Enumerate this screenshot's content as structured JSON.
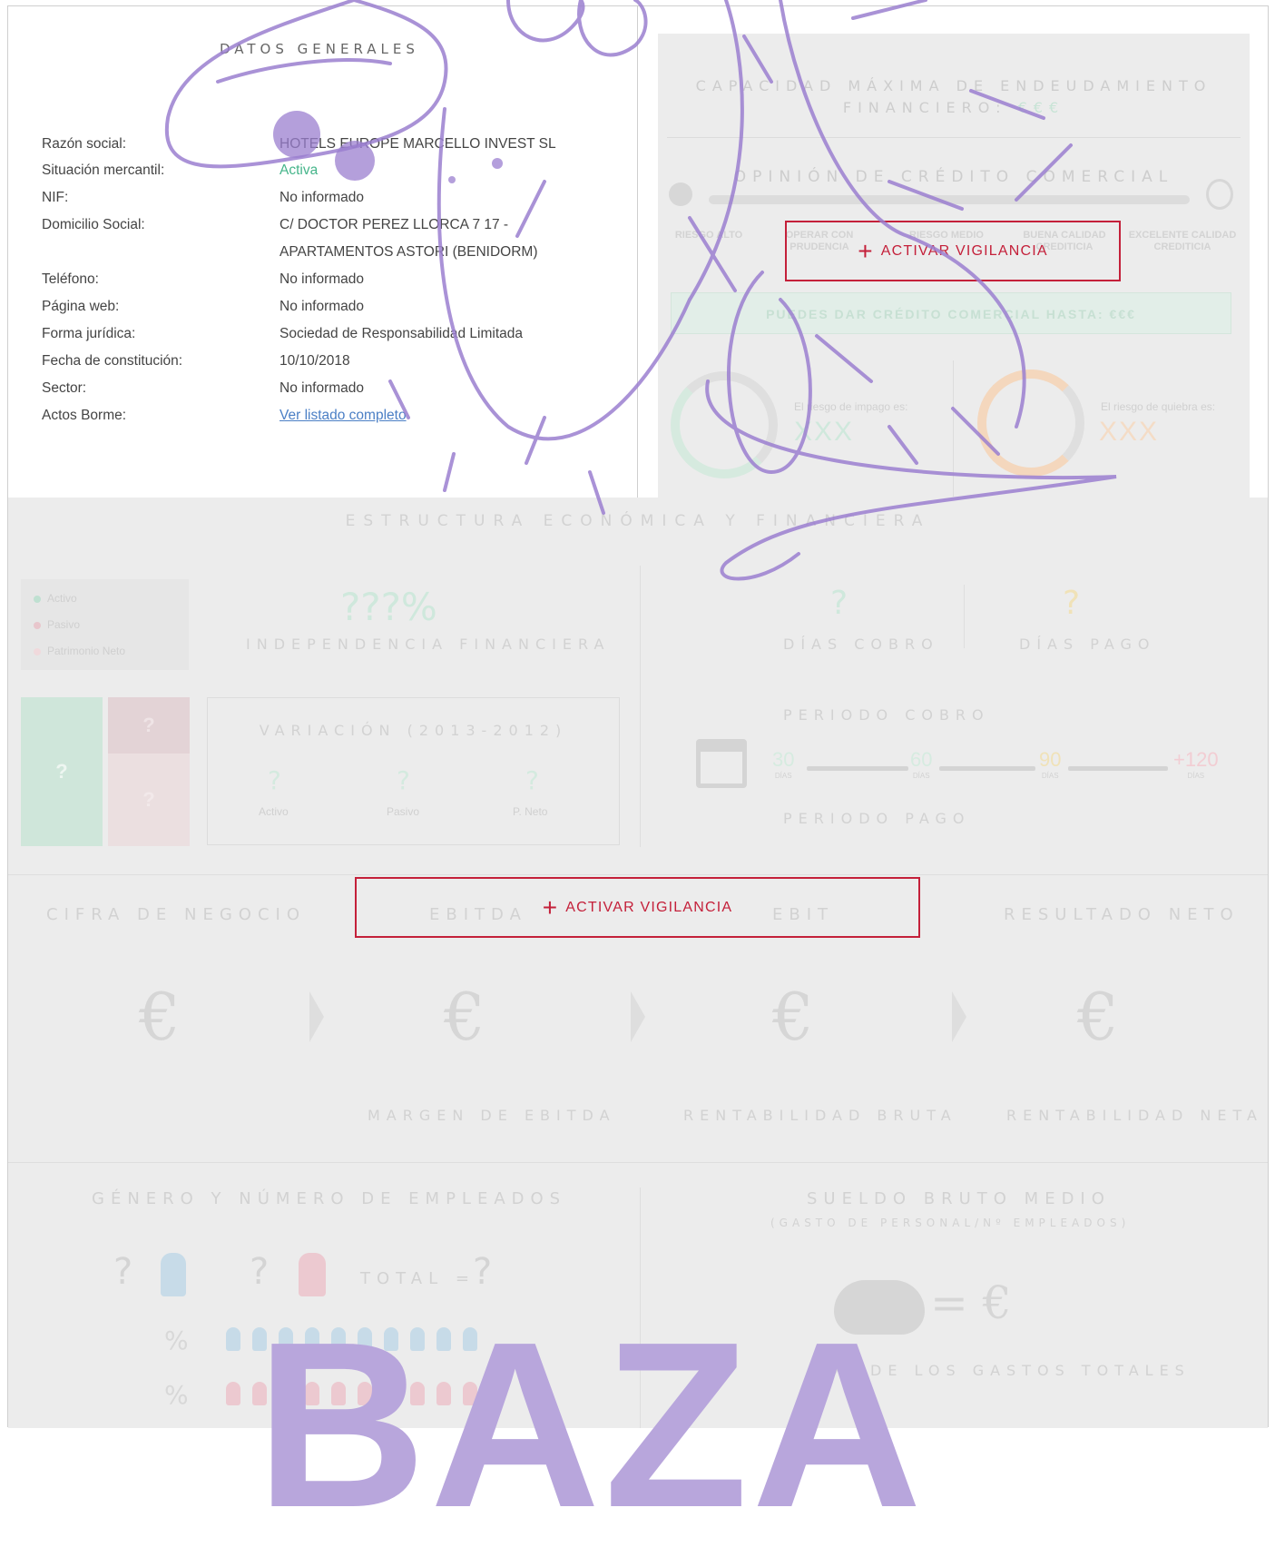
{
  "general": {
    "title": "DATOS GENERALES",
    "fields": [
      {
        "label": "Razón social:",
        "value": "HOTELS EUROPE MARCELLO INVEST SL"
      },
      {
        "label": "Situación mercantil:",
        "value": "Activa"
      },
      {
        "label": "NIF:",
        "value": "No informado"
      },
      {
        "label": "Domicilio Social:",
        "value": "C/ DOCTOR PEREZ LLORCA 7 17 - APARTAMENTOS ASTORI (BENIDORM)"
      },
      {
        "label": "Teléfono:",
        "value": "No informado"
      },
      {
        "label": "Página web:",
        "value": "No informado"
      },
      {
        "label": "Forma jurídica:",
        "value": "Sociedad de Responsabilidad Limitada"
      },
      {
        "label": "Fecha de constitución:",
        "value": "10/10/2018"
      },
      {
        "label": "Sector:",
        "value": "No informado"
      },
      {
        "label": "Actos Borme:",
        "value": "Ver listado completo"
      }
    ]
  },
  "credit": {
    "capacity_title": "CAPACIDAD MÁXIMA DE ENDEUDAMIENTO FINANCIERO:",
    "capacity_value": "€€€",
    "opinion_title": "OPINIÓN DE CRÉDITO COMERCIAL",
    "risk_labels": [
      "RIESGO ALTO",
      "OPERAR CON PRUDENCIA",
      "RIESGO MEDIO",
      "BUENA CALIDAD CREDITICIA",
      "EXCELENTE CALIDAD CREDITICIA"
    ],
    "credit_limit": "PUEDES DAR CRÉDITO COMERCIAL HASTA: €€€",
    "impago_label": "El riesgo de impago es:",
    "impago_value": "XXX",
    "quiebra_label": "El riesgo de quiebra es:",
    "quiebra_value": "XXX",
    "activate_label": "ACTIVAR VIGILANCIA"
  },
  "structure": {
    "title": "ESTRUCTURA ECONÓMICA Y FINANCIERA",
    "legend": [
      "Activo",
      "Pasivo",
      "Patrimonio Neto"
    ],
    "independence_value": "???%",
    "independence_label": "INDEPENDENCIA FINANCIERA",
    "bar_q": "?",
    "variation_title": "VARIACIÓN (2013-2012)",
    "variation_items": [
      {
        "q": "?",
        "label": "Activo"
      },
      {
        "q": "?",
        "label": "Pasivo"
      },
      {
        "q": "?",
        "label": "P. Neto"
      }
    ],
    "dias_cobro_q": "?",
    "dias_cobro_label": "DÍAS COBRO",
    "dias_pago_q": "?",
    "dias_pago_label": "DÍAS PAGO",
    "periodo_cobro": "PERIODO COBRO",
    "periodo_pago": "PERIODO PAGO",
    "ticks": [
      "30",
      "60",
      "90",
      "+120"
    ],
    "tick_unit": "DÍAS"
  },
  "results": {
    "headers": [
      "CIFRA DE NEGOCIO",
      "EBITDA",
      "EBIT",
      "RESULTADO NETO"
    ],
    "euro": "€",
    "footers": [
      "MARGEN DE EBITDA",
      "RENTABILIDAD BRUTA",
      "RENTABILIDAD NETA"
    ],
    "activate_label": "ACTIVAR VIGILANCIA"
  },
  "employees": {
    "title": "GÉNERO Y NÚMERO DE EMPLEADOS",
    "q": "?",
    "total_label": "TOTAL =",
    "percent": "%",
    "salary_title": "SUELDO BRUTO MEDIO",
    "salary_subtitle": "(GASTO DE PERSONAL/Nº EMPLEADOS)",
    "salary_eq": "= €",
    "salary_pct_label": "DE LOS GASTOS TOTALES"
  },
  "watermark": "BAZA",
  "colors": {
    "accent": "#c4203a",
    "green": "#45b58a",
    "link": "#4b7fc5",
    "orange": "#f0c8a0",
    "doodle": "#9b7fd0"
  }
}
